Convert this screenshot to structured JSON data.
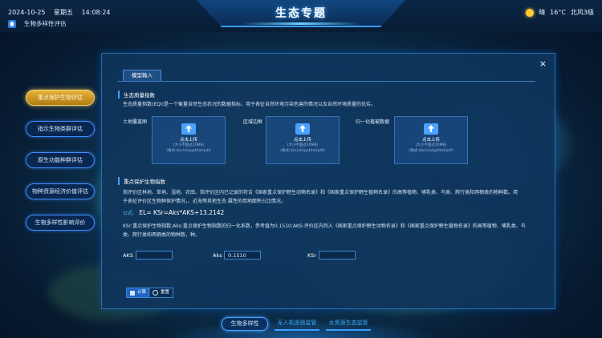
{
  "header": {
    "date": "2024-10-25",
    "weekday": "星期五",
    "time": "14:08:24",
    "title": "生态专题",
    "weather_condition": "晴",
    "temperature": "16°C",
    "wind": "北风3级",
    "breadcrumb": "生物多样性评估"
  },
  "sidebar": {
    "items": [
      {
        "label": "重点保护生物评估",
        "active": true
      },
      {
        "label": "指示生物类群评估",
        "active": false
      },
      {
        "label": "原生功能种群评估",
        "active": false
      },
      {
        "label": "物种资源经济价值评估",
        "active": false
      },
      {
        "label": "生物多样性影响评价",
        "active": false
      }
    ]
  },
  "modal": {
    "tab_label": "模型输入",
    "close_symbol": "×",
    "section1": {
      "title": "生态质量指数",
      "description": "生态质量指数(EQI)是一个衡量自然生态状况的数据指标，用于表征自然环境污染危害的情况以及自然环境质量的优劣。"
    },
    "uploads": [
      {
        "label": "土地覆盖图",
        "action": "点击上传",
        "size_hint": "(大小不超过20MB)",
        "format_hint": "(格式:doc/xls/ppt/txt/pdf)"
      },
      {
        "label": "区域边框",
        "action": "点击上传",
        "size_hint": "(大小不超过20MB)",
        "format_hint": "(格式:doc/xls/ppt/txt/pdf)"
      },
      {
        "label": "归一化植被数据",
        "action": "点击上传",
        "size_hint": "(大小不超过20MB)",
        "format_hint": "(格式:doc/xls/ppt/txt/pdf)"
      }
    ],
    "section2": {
      "title": "重点保护生物指数",
      "description_line1": "指评价区林地、草地、湿地、农田、指评价区内已记录的符合《国家重点保护野生动物名录》和《国家重点保护野生植物名录》的高等植物、哺乳类、鸟类、爬行类和两栖类的物种数。用",
      "description_line2": "于表征评价区生物种保护情况，、近海等其他生态 属性的用地面积占比情况。",
      "formula_label": "公式:",
      "formula": "EL= KSr=Aks*AKS+13.2142",
      "explain_line1": "KSr:重点保护生物指数;Aks:重点保护生物指数的归一化系数，参考值为0.1510;AKS:评价区内列入《国家重点保护野生动物名录》和《国家重点保护野生植物名录》的高等植物、哺乳类、鸟",
      "explain_line2": "类、爬行类和两栖类的物种数，种。"
    },
    "fields": [
      {
        "label": "AKS",
        "value": ""
      },
      {
        "label": "Aks",
        "value": "0.1510"
      },
      {
        "label": "KSr",
        "value": ""
      }
    ],
    "calc_button": "计算",
    "reset_button": "重置"
  },
  "bottom_tabs": [
    {
      "label": "生物多样性"
    },
    {
      "label": "无人机遥感监管"
    },
    {
      "label": "水资源生态监管"
    }
  ]
}
